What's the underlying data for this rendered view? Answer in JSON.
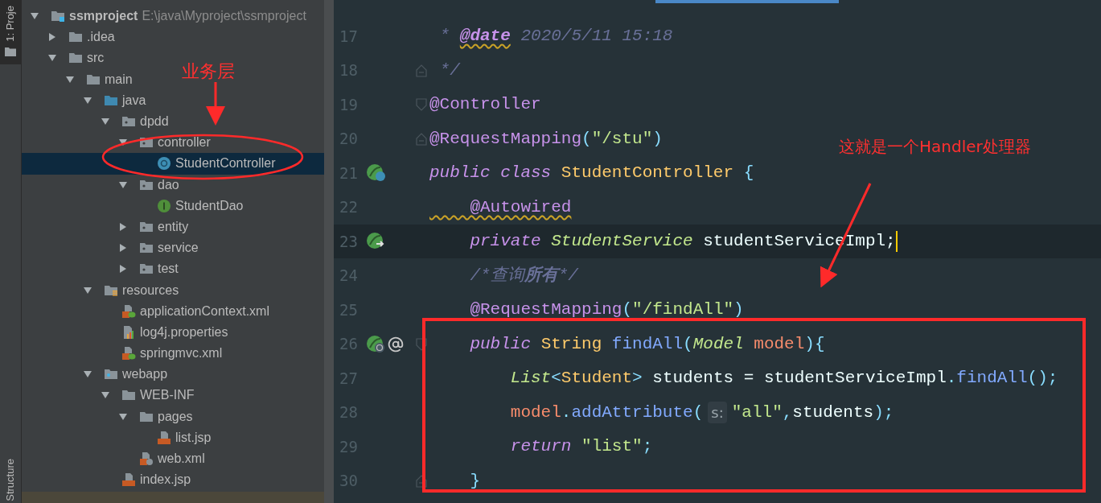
{
  "tool_strip": {
    "top_tab": "1: Proje",
    "bottom_tab": "Structure"
  },
  "project_tree": [
    {
      "name": "ssmproject",
      "path": "E:\\java\\Myproject\\ssmproject",
      "kind": "module",
      "expanded": true,
      "selected": false,
      "children": [
        {
          "name": ".idea",
          "kind": "folder",
          "expanded": false,
          "selected": false
        },
        {
          "name": "src",
          "kind": "folder",
          "expanded": true,
          "selected": false,
          "children": [
            {
              "name": "main",
              "kind": "folder",
              "expanded": true,
              "selected": false,
              "children": [
                {
                  "name": "java",
                  "kind": "source-root",
                  "expanded": true,
                  "selected": false,
                  "children": [
                    {
                      "name": "dpdd",
                      "kind": "package",
                      "expanded": true,
                      "selected": false,
                      "children": [
                        {
                          "name": "controller",
                          "kind": "package",
                          "expanded": true,
                          "selected": false,
                          "children": [
                            {
                              "name": "StudentController",
                              "kind": "class",
                              "selected": true
                            }
                          ]
                        },
                        {
                          "name": "dao",
                          "kind": "package",
                          "expanded": true,
                          "selected": false,
                          "children": [
                            {
                              "name": "StudentDao",
                              "kind": "interface",
                              "selected": false
                            }
                          ]
                        },
                        {
                          "name": "entity",
                          "kind": "package",
                          "expanded": false,
                          "selected": false
                        },
                        {
                          "name": "service",
                          "kind": "package",
                          "expanded": false,
                          "selected": false
                        },
                        {
                          "name": "test",
                          "kind": "package",
                          "expanded": false,
                          "selected": false
                        }
                      ]
                    }
                  ]
                },
                {
                  "name": "resources",
                  "kind": "resources-root",
                  "expanded": true,
                  "selected": false,
                  "children": [
                    {
                      "name": "applicationContext.xml",
                      "kind": "spring-xml",
                      "selected": false
                    },
                    {
                      "name": "log4j.properties",
                      "kind": "properties",
                      "selected": false
                    },
                    {
                      "name": "springmvc.xml",
                      "kind": "spring-xml",
                      "selected": false
                    }
                  ]
                },
                {
                  "name": "webapp",
                  "kind": "web-root",
                  "expanded": true,
                  "selected": false,
                  "children": [
                    {
                      "name": "WEB-INF",
                      "kind": "folder",
                      "expanded": true,
                      "selected": false,
                      "children": [
                        {
                          "name": "pages",
                          "kind": "folder",
                          "expanded": true,
                          "selected": false,
                          "children": [
                            {
                              "name": "list.jsp",
                              "kind": "jsp",
                              "selected": false
                            }
                          ]
                        },
                        {
                          "name": "web.xml",
                          "kind": "web-xml",
                          "selected": false
                        }
                      ]
                    },
                    {
                      "name": "index.jsp",
                      "kind": "jsp",
                      "selected": false
                    }
                  ]
                }
              ]
            }
          ]
        }
      ]
    }
  ],
  "editor": {
    "lines": [
      {
        "number": "17",
        "tokens": [
          {
            "text": " * ",
            "kind": "comment"
          },
          {
            "text": "@date",
            "kind": "doc-tag",
            "underlined": true
          },
          {
            "text": " 2020/5/11 15:18",
            "kind": "comment"
          }
        ]
      },
      {
        "number": "18",
        "fold": {
          "kind": "end"
        },
        "tokens": [
          {
            "text": " */",
            "kind": "comment"
          }
        ]
      },
      {
        "number": "19",
        "fold": {
          "kind": "start"
        },
        "tokens": [
          {
            "text": "@Controller",
            "kind": "annotation"
          }
        ]
      },
      {
        "number": "20",
        "fold": {
          "kind": "end"
        },
        "tokens": [
          {
            "text": "@RequestMapping",
            "kind": "annotation"
          },
          {
            "text": "(",
            "kind": "punct"
          },
          {
            "text": "\"/stu\"",
            "kind": "string"
          },
          {
            "text": ")",
            "kind": "punct"
          }
        ]
      },
      {
        "number": "21",
        "gutter_icons": [
          {
            "kind": "bean-class"
          }
        ],
        "tokens": [
          {
            "text": "public class ",
            "kind": "keyword"
          },
          {
            "text": "StudentController ",
            "kind": "type"
          },
          {
            "text": "{",
            "kind": "punct"
          }
        ]
      },
      {
        "number": "22",
        "tokens": [
          {
            "text": "    @Autowired",
            "kind": "annotation",
            "underlined": true
          }
        ]
      },
      {
        "number": "23",
        "current": true,
        "caret": true,
        "gutter_icons": [
          {
            "kind": "autowired"
          }
        ],
        "tokens": [
          {
            "text": "    private ",
            "kind": "keyword"
          },
          {
            "text": "StudentService ",
            "kind": "interface"
          },
          {
            "text": "studentServiceImpl;",
            "kind": "plain"
          }
        ]
      },
      {
        "number": "24",
        "tokens": [
          {
            "text": "    /*查询",
            "kind": "comment"
          },
          {
            "text": "所有",
            "kind": "comment-bold"
          },
          {
            "text": "*/",
            "kind": "comment"
          }
        ]
      },
      {
        "number": "25",
        "tokens": [
          {
            "text": "    @RequestMapping",
            "kind": "annotation"
          },
          {
            "text": "(",
            "kind": "punct"
          },
          {
            "text": "\"/findAll\"",
            "kind": "string"
          },
          {
            "text": ")",
            "kind": "punct"
          }
        ]
      },
      {
        "number": "26",
        "fold": {
          "kind": "start"
        },
        "gutter_icons": [
          {
            "kind": "web-bean"
          },
          {
            "kind": "at-sign"
          }
        ],
        "tokens": [
          {
            "text": "    public ",
            "kind": "keyword"
          },
          {
            "text": "String ",
            "kind": "type"
          },
          {
            "text": "findAll",
            "kind": "method"
          },
          {
            "text": "(",
            "kind": "punct"
          },
          {
            "text": "Model ",
            "kind": "interface"
          },
          {
            "text": "model",
            "kind": "param"
          },
          {
            "text": "){",
            "kind": "punct"
          }
        ]
      },
      {
        "number": "27",
        "tokens": [
          {
            "text": "        List",
            "kind": "interface"
          },
          {
            "text": "<",
            "kind": "punct"
          },
          {
            "text": "Student",
            "kind": "type"
          },
          {
            "text": ">",
            "kind": "punct"
          },
          {
            "text": " students = studentServiceImpl",
            "kind": "plain"
          },
          {
            "text": ".",
            "kind": "punct"
          },
          {
            "text": "findAll",
            "kind": "method"
          },
          {
            "text": "();",
            "kind": "punct"
          }
        ]
      },
      {
        "number": "28",
        "tokens": [
          {
            "text": "        model",
            "kind": "param"
          },
          {
            "text": ".",
            "kind": "punct"
          },
          {
            "text": "addAttribute",
            "kind": "method"
          },
          {
            "text": "(",
            "kind": "punct"
          },
          {
            "text": "s:",
            "kind": "hint"
          },
          {
            "text": "\"all\"",
            "kind": "string"
          },
          {
            "text": ",",
            "kind": "punct"
          },
          {
            "text": "students",
            "kind": "plain"
          },
          {
            "text": ");",
            "kind": "punct"
          }
        ]
      },
      {
        "number": "29",
        "tokens": [
          {
            "text": "        return ",
            "kind": "keyword"
          },
          {
            "text": "\"list\"",
            "kind": "string"
          },
          {
            "text": ";",
            "kind": "punct"
          }
        ]
      },
      {
        "number": "30",
        "fold": {
          "kind": "end"
        },
        "tokens": [
          {
            "text": "    }",
            "kind": "punct"
          }
        ]
      }
    ]
  },
  "annotations": [
    {
      "text": "业务层"
    },
    {
      "text": "这就是一个Handler处理器"
    }
  ]
}
